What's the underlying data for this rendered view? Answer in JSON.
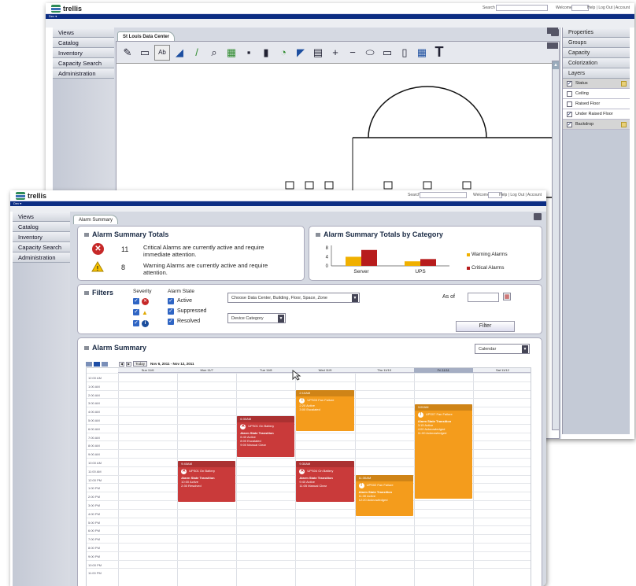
{
  "back": {
    "logo": "trellis",
    "search_label": "Search",
    "welcome": "Welcome",
    "links": "Help | Log Out | Account",
    "nav_strip": "Dev ▾",
    "nav": [
      "Views",
      "Catalog",
      "Inventory",
      "Capacity Search",
      "Administration"
    ],
    "tab": "St Louis Data Center",
    "right_panels": [
      "Properties",
      "Groups",
      "Capacity",
      "Colorization",
      "Layers"
    ],
    "layers": [
      {
        "label": "Status",
        "checked": true,
        "locked": true,
        "style": "sel"
      },
      {
        "label": "Ceiling",
        "checked": false,
        "locked": false,
        "style": "on"
      },
      {
        "label": "Raised Floor",
        "checked": false,
        "locked": false,
        "style": "on"
      },
      {
        "label": "Under Raised Floor",
        "checked": true,
        "locked": false,
        "style": "on"
      },
      {
        "label": "Backdrop",
        "checked": true,
        "locked": true,
        "style": "sel"
      }
    ],
    "tools": [
      "✎",
      "▭",
      "Ab",
      "◢",
      "/",
      "⌕",
      "▦",
      "▪",
      "▮",
      "◔",
      "◤",
      "▤",
      "+",
      "−",
      "⬭",
      "▭",
      "▯",
      "▦",
      "T"
    ]
  },
  "front": {
    "logo": "trellis",
    "search_label": "Search",
    "welcome": "Welcome",
    "links": "Help | Log Out | Account",
    "nav_strip": "Dev ▾",
    "nav": [
      "Views",
      "Catalog",
      "Inventory",
      "Capacity Search",
      "Administration"
    ],
    "tab": "Alarm Summary",
    "totals": {
      "title": "Alarm Summary Totals",
      "critical_count": "11",
      "critical_text": "Critical Alarms are currently active and require immediate attention.",
      "warning_count": "8",
      "warning_text": "Warning Alarms are currently active and require attention."
    },
    "by_category": {
      "title": "Alarm Summary Totals by Category",
      "legend_warning": "Warning Alarms",
      "legend_critical": "Critical Alarms",
      "warning_color": "#f0b000",
      "critical_color": "#b71c1c"
    },
    "filters": {
      "title": "Filters",
      "severity_label": "Severity",
      "state_label": "Alarm State",
      "states": [
        "Active",
        "Suppressed",
        "Resolved"
      ],
      "location_select": "Choose Data Center, Building, Floor, Space, Zone",
      "device_select": "Device Category",
      "as_of_label": "As of",
      "filter_button": "Filter"
    },
    "calendar": {
      "title": "Alarm Summary",
      "view_select": "Calendar",
      "today": "Today",
      "range": "Nov 6, 2011 - Nov 12, 2011",
      "days": [
        "Sun 11/6",
        "Mon 11/7",
        "Tue 11/8",
        "Wed 11/9",
        "Thu 11/10",
        "Fri 11/11",
        "Sat 11/12"
      ],
      "times": [
        "12:00 AM",
        "1:00 AM",
        "2:00 AM",
        "3:00 AM",
        "4:00 AM",
        "5:00 AM",
        "6:00 AM",
        "7:00 AM",
        "8:00 AM",
        "9:00 AM",
        "10:00 AM",
        "11:00 AM",
        "12:00 PM",
        "1:00 PM",
        "2:00 PM",
        "3:00 PM",
        "4:00 PM",
        "5:00 PM",
        "6:00 PM",
        "7:00 PM",
        "8:00 PM",
        "9:00 PM",
        "10:00 PM",
        "11:00 PM"
      ],
      "events": [
        {
          "color": "red",
          "time": "6:30AM",
          "name": "UPS01 On Battery",
          "heading": "Alarm State Transition",
          "lines": [
            "6:40 Active",
            "8:00 Escalated",
            "9:00 Manual Clear"
          ]
        },
        {
          "color": "orange",
          "time": "2:10AM",
          "name": "UPS03 Fan Failure",
          "heading": "",
          "lines": [
            "2:20 Active",
            "3:00 Escalated"
          ]
        },
        {
          "color": "orange",
          "time": "3:00AM",
          "name": "UPS07 Fan Failure",
          "heading": "Alarm State Transition",
          "lines": [
            "3:15 Active",
            "4:00 Acknowledged",
            "11:00 Acknowledged"
          ]
        },
        {
          "color": "red",
          "time": "9:40AM",
          "name": "UPS01 On Battery",
          "heading": "Alarm State Transition",
          "lines": [
            "10:00 Active",
            "2:30 Resolved"
          ]
        },
        {
          "color": "red",
          "time": "9:30AM",
          "name": "UPS04 On Battery",
          "heading": "Alarm State Transition",
          "lines": [
            "9:40 Active",
            "11:05 Manual Clear"
          ]
        },
        {
          "color": "orange",
          "time": "11:30AM",
          "name": "UPS02 Fan Failure",
          "heading": "Alarm State Transition",
          "lines": [
            "11:30 Active",
            "12:20 Acknowledged"
          ]
        }
      ]
    }
  },
  "chart_data": {
    "type": "bar",
    "categories": [
      "Server",
      "UPS"
    ],
    "series": [
      {
        "name": "Warning Alarms",
        "values": [
          4,
          2
        ]
      },
      {
        "name": "Critical Alarms",
        "values": [
          7,
          3
        ]
      }
    ],
    "yticks": [
      "0",
      "4",
      "8"
    ],
    "ylim": [
      0,
      9
    ]
  }
}
